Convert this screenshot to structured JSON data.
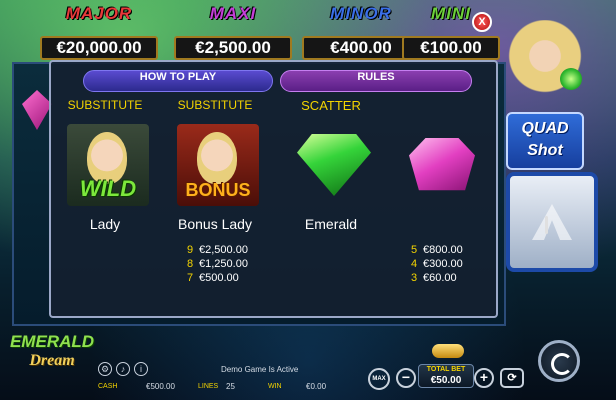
{
  "jackpots": [
    {
      "title": "MAJOR",
      "value": "€20,000.00",
      "color": "#e8393a"
    },
    {
      "title": "MAXI",
      "value": "€2,500.00",
      "color": "#c43fd8"
    },
    {
      "title": "MINOR",
      "value": "€400.00",
      "color": "#3a6fe8"
    },
    {
      "title": "MINI",
      "value": "€100.00",
      "color": "#6cd13a"
    }
  ],
  "side_logo": {
    "line1": "QUAD",
    "line2": "Shot"
  },
  "panel": {
    "tab_how_to_play": "HOW TO PLAY",
    "tab_rules": "RULES",
    "close_label": "X",
    "symbols": [
      {
        "header": "SUBSTITUTE",
        "name": "Lady",
        "art": "lady-wild",
        "badge": "WILD",
        "pays": []
      },
      {
        "header": "SUBSTITUTE",
        "name": "Bonus Lady",
        "art": "lady-bonus",
        "badge": "BONUS",
        "pays": [
          {
            "count": "9",
            "amount": "€2,500.00"
          },
          {
            "count": "8",
            "amount": "€1,250.00"
          },
          {
            "count": "7",
            "amount": "€500.00"
          }
        ]
      },
      {
        "header": "SCATTER",
        "name": "Emerald",
        "art": "emerald-gem",
        "pays": []
      },
      {
        "header": "",
        "name": "",
        "art": "pink-gem",
        "pays": [
          {
            "count": "5",
            "amount": "€800.00"
          },
          {
            "count": "4",
            "amount": "€300.00"
          },
          {
            "count": "3",
            "amount": "€60.00"
          }
        ]
      }
    ]
  },
  "game_logo": {
    "line1": "EMERALD",
    "line2": "Dream"
  },
  "status": {
    "message": "Demo Game Is Active",
    "cash_label": "CASH",
    "cash_value": "€500.00",
    "lines_label": "LINES",
    "lines_value": "25",
    "win_label": "WIN",
    "win_value": "€0.00",
    "total_bet_label": "TOTAL BET",
    "total_bet_value": "€50.00",
    "info_icon_glyph": "i",
    "max_label": "MAX"
  }
}
